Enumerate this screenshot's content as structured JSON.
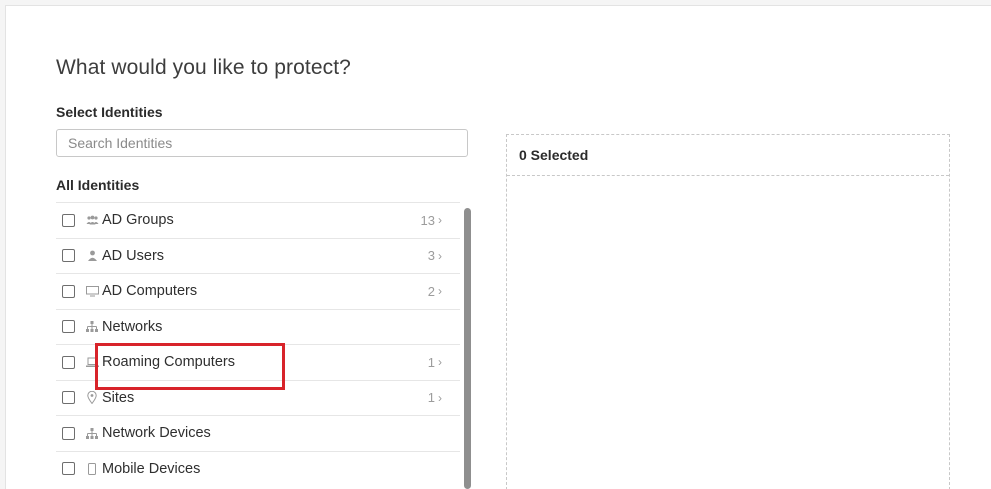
{
  "page": {
    "title": "What would you like to protect?"
  },
  "identities": {
    "select_label": "Select Identities",
    "search_placeholder": "Search Identities",
    "search_value": "",
    "all_label": "All Identities",
    "items": [
      {
        "label": "AD Groups",
        "icon": "group-icon",
        "count": "13"
      },
      {
        "label": "AD Users",
        "icon": "user-icon",
        "count": "3"
      },
      {
        "label": "AD Computers",
        "icon": "monitor-icon",
        "count": "2"
      },
      {
        "label": "Networks",
        "icon": "network-icon",
        "count": ""
      },
      {
        "label": "Roaming Computers",
        "icon": "laptop-icon",
        "count": "1"
      },
      {
        "label": "Sites",
        "icon": "location-pin-icon",
        "count": "1"
      },
      {
        "label": "Network Devices",
        "icon": "network-icon",
        "count": ""
      },
      {
        "label": "Mobile Devices",
        "icon": "mobile-icon",
        "count": ""
      }
    ]
  },
  "selection": {
    "header": "0 Selected"
  },
  "colors": {
    "highlight": "#d8232a",
    "scrollbar": "#8f8f8f",
    "icon": "#9a9a9a"
  }
}
